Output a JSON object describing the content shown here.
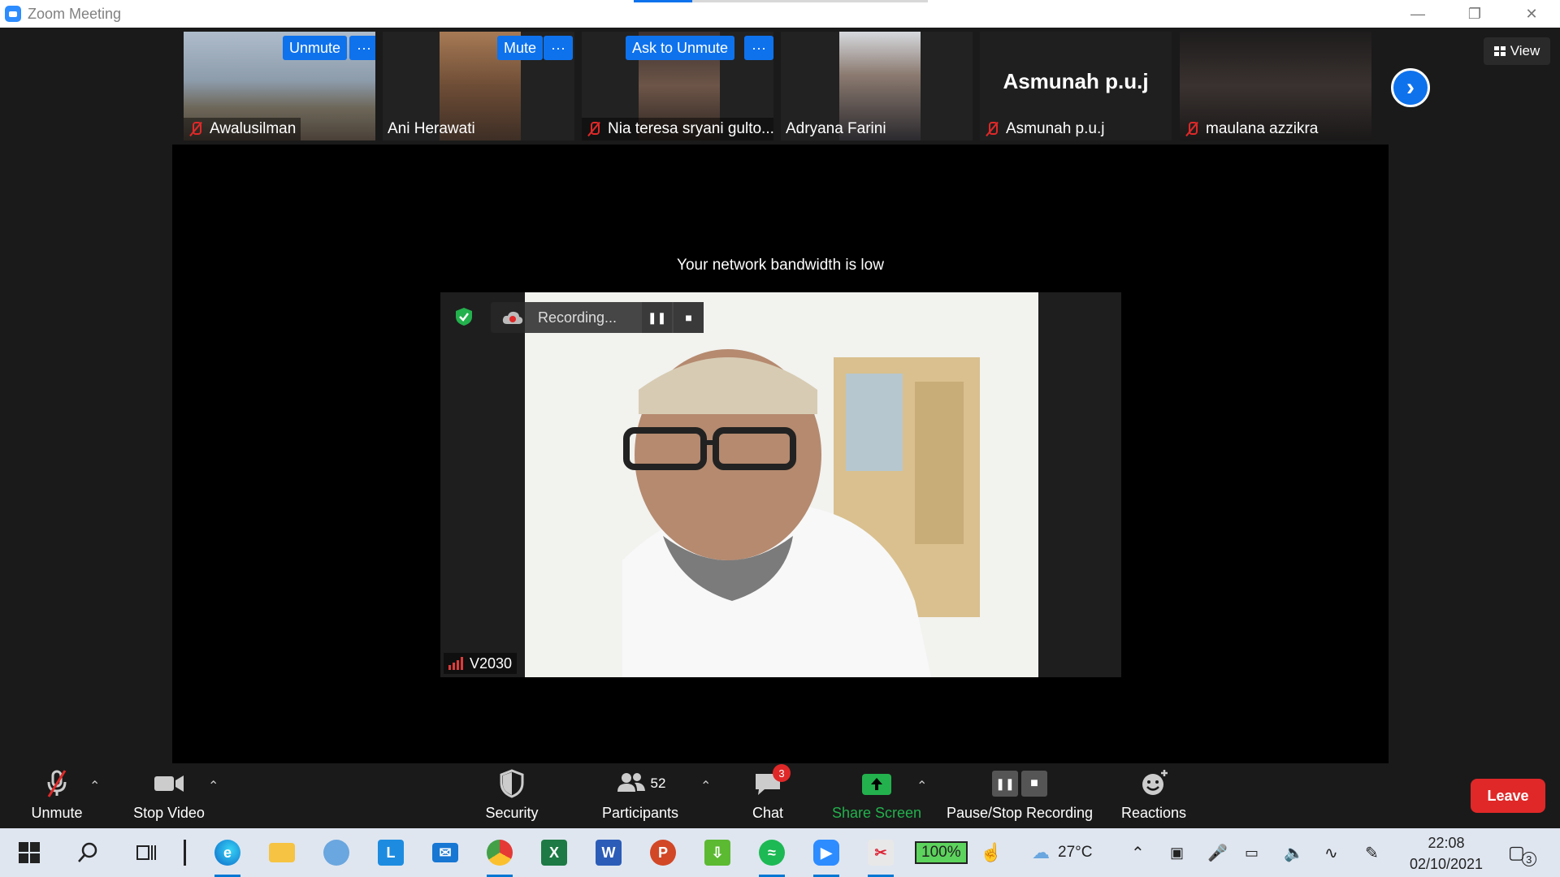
{
  "window": {
    "title": "Zoom Meeting",
    "controls": [
      "minimize-icon",
      "restore-icon",
      "close-icon"
    ]
  },
  "participants_strip": [
    {
      "name": "Awalusilman",
      "muted": true,
      "buttons": [
        "Unmute",
        "···"
      ]
    },
    {
      "name": "Ani Herawati",
      "muted": false,
      "buttons": [
        "Mute",
        "···"
      ]
    },
    {
      "name": "Nia teresa sryani gulto...",
      "muted": true,
      "buttons": [
        "Ask to Unmute",
        "···"
      ]
    },
    {
      "name": "Adryana Farini",
      "muted": false,
      "buttons": []
    },
    {
      "name": "Asmunah p.u.j",
      "display_name": "Asmunah p.u.j",
      "muted": true,
      "buttons": []
    },
    {
      "name": "maulana azzikra",
      "muted": true,
      "buttons": []
    }
  ],
  "view_button": "View",
  "stage": {
    "notice": "Your network bandwidth is low",
    "recording_label": "Recording...",
    "active_speaker": "V2030"
  },
  "toolbar": {
    "unmute": "Unmute",
    "stop_video": "Stop Video",
    "security": "Security",
    "participants": "Participants",
    "participants_count": "52",
    "chat": "Chat",
    "chat_badge": "3",
    "share_screen": "Share Screen",
    "recording": "Pause/Stop Recording",
    "reactions": "Reactions",
    "leave": "Leave"
  },
  "taskbar": {
    "battery": "100%",
    "weather": "27°C",
    "time": "22:08",
    "date": "02/10/2021",
    "notifications": "3",
    "apps": [
      "windows-start",
      "search",
      "task-view",
      "edge",
      "file-explorer",
      "cloud-app",
      "l-app",
      "mail",
      "chrome",
      "excel",
      "word",
      "powerpoint",
      "download-app",
      "spotify",
      "zoom",
      "snipping-tool"
    ]
  },
  "colors": {
    "zoom_blue": "#0e72ed",
    "leave_red": "#e02828",
    "share_green": "#23b14d",
    "meeting_bg": "#1a1a1a"
  }
}
